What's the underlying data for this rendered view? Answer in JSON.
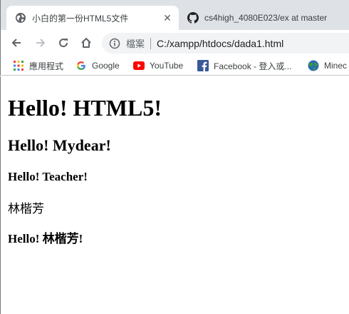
{
  "tabs": [
    {
      "title": "小白的第一份HTML5文件",
      "active": true,
      "icon": "globe-icon"
    },
    {
      "title": "cs4high_4080E023/ex at master",
      "active": false,
      "icon": "github-icon"
    }
  ],
  "toolbar": {
    "security_label": "檔案",
    "url": "C:/xampp/htdocs/dada1.html"
  },
  "bookmarks": [
    {
      "label": "應用程式",
      "icon": "apps-grid-icon"
    },
    {
      "label": "Google",
      "icon": "google-icon"
    },
    {
      "label": "YouTube",
      "icon": "youtube-icon"
    },
    {
      "label": "Facebook - 登入或...",
      "icon": "facebook-icon"
    },
    {
      "label": "Minec",
      "icon": "minecraft-globe-icon"
    }
  ],
  "page": {
    "h1": "Hello! HTML5!",
    "h2": "Hello! Mydear!",
    "h3": "Hello! Teacher!",
    "paragraph": "林楷芳",
    "h3b": "Hello! 林楷芳!"
  },
  "colors": {
    "tabstrip_bg": "#dee1e6",
    "omnibox_bg": "#f1f3f4",
    "youtube_red": "#ff0000",
    "facebook_blue": "#3b5998"
  }
}
